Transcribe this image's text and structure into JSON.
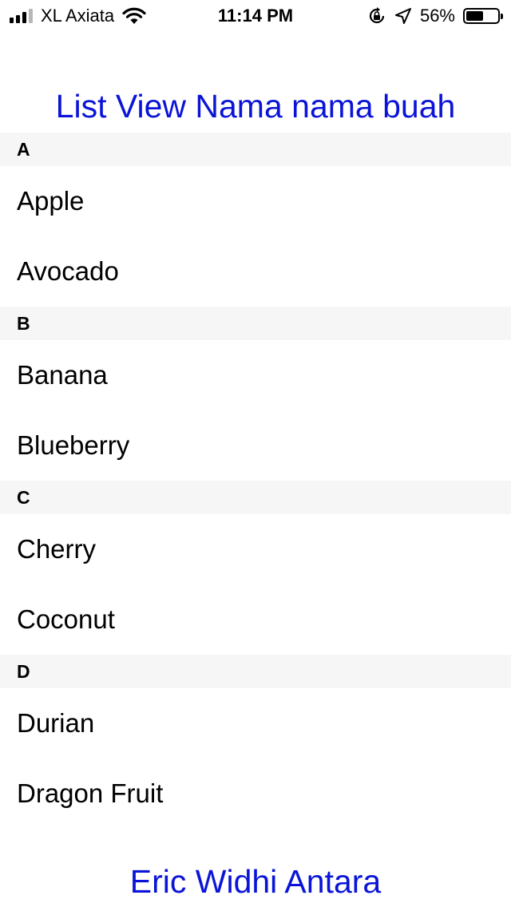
{
  "status_bar": {
    "carrier": "XL Axiata",
    "time": "11:14 PM",
    "battery_percent_label": "56%",
    "battery_level": 0.56,
    "signal_bars_active": 3,
    "signal_bars_total": 4
  },
  "title": "List View Nama nama buah",
  "sections": [
    {
      "header": "A",
      "items": [
        "Apple",
        "Avocado"
      ]
    },
    {
      "header": "B",
      "items": [
        "Banana",
        "Blueberry"
      ]
    },
    {
      "header": "C",
      "items": [
        "Cherry",
        "Coconut"
      ]
    },
    {
      "header": "D",
      "items": [
        "Durian",
        "Dragon Fruit"
      ]
    }
  ],
  "footer": "Eric Widhi Antara",
  "colors": {
    "accent": "#0a14d8",
    "section_bg": "#f6f6f6"
  }
}
